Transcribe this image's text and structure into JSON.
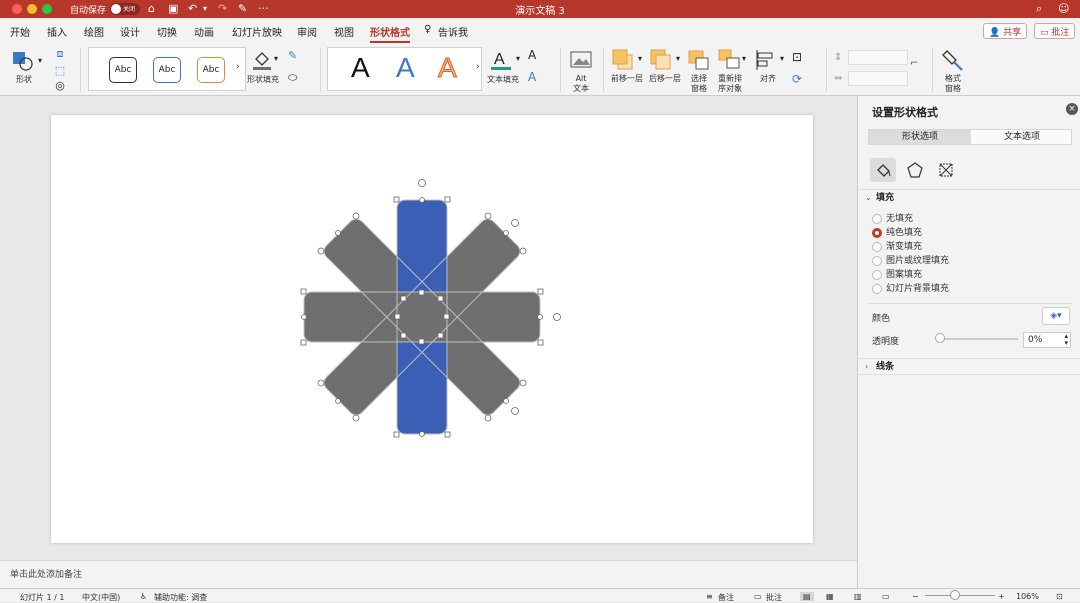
{
  "window": {
    "title": "演示文稿 3",
    "autosave_label": "自动保存",
    "autosave_state": "关闭"
  },
  "tabs": [
    "开始",
    "插入",
    "绘图",
    "设计",
    "切换",
    "动画",
    "幻灯片放映",
    "审阅",
    "视图",
    "形状格式"
  ],
  "tell_me": "告诉我",
  "share_label": "共享",
  "comments_label": "批注",
  "ribbon": {
    "shape_label": "形状",
    "abc_samples": [
      "Abc",
      "Abc",
      "Abc"
    ],
    "shape_fill_label": "形状填充",
    "text_fill_label": "文本填充",
    "alt_text_label": "Alt\n文本",
    "bring_forward_label": "前移一层",
    "send_backward_label": "后移一层",
    "selection_pane_label": "选择\n窗格",
    "reorder_label": "重新排\n序对象",
    "align_label": "对齐",
    "format_painter_label": "格式\n窗格",
    "wordart_letter": "A"
  },
  "notes_placeholder": "单击此处添加备注",
  "status": {
    "slide_info": "幻灯片 1 / 1",
    "language": "中文(中国)",
    "accessibility": "辅助功能: 调查",
    "notes_btn": "备注",
    "comments_btn": "批注",
    "zoom": "106%"
  },
  "format_pane": {
    "title": "设置形状格式",
    "tab_shape": "形状选项",
    "tab_text": "文本选项",
    "fill_section": "填充",
    "fill_options": [
      "无填充",
      "纯色填充",
      "渐变填充",
      "图片或纹理填充",
      "图案填充",
      "幻灯片背景填充"
    ],
    "selected_fill": "纯色填充",
    "color_label": "颜色",
    "transparency_label": "透明度",
    "transparency_value": "0%",
    "line_section": "线条"
  },
  "colors": {
    "accent": "#b7372a",
    "shape_gray": "#6f6f6f",
    "shape_blue": "#3a5fb5"
  }
}
